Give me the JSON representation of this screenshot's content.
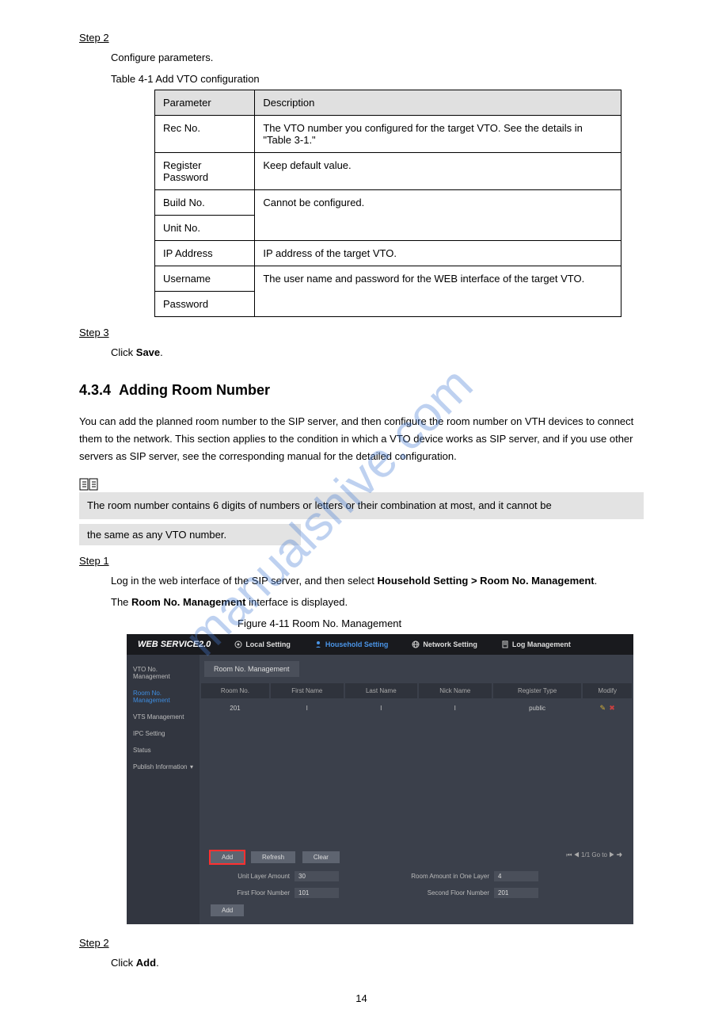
{
  "step2": {
    "label": "Step 2",
    "desc": "Configure parameters.",
    "tableCaption": "Table 4-1   Add VTO configuration",
    "headers": [
      "Parameter",
      "Description"
    ],
    "rows": [
      [
        "Rec No.",
        "The VTO number you configured for the target VTO. See the details in \"Table 3-1.\""
      ],
      [
        "Register Password",
        "Keep default value."
      ],
      [
        "Build No.",
        ""
      ],
      [
        "Unit No.",
        "Cannot be configured."
      ],
      [
        "IP Address",
        "IP address of the target VTO."
      ],
      [
        "Username",
        ""
      ],
      [
        "Password",
        "The user name and password for the WEB interface of the target VTO."
      ]
    ]
  },
  "step3": {
    "label": "Step 3",
    "desc": "Click Save."
  },
  "section": {
    "number": "4.3.4",
    "title": "Adding Room Number",
    "text": "You can add the planned room number to the SIP server, and then configure the room number on VTH devices to connect them to the network. This section applies to the condition in which a VTO device works as SIP server, and if you use other servers as SIP server, see the corresponding manual for the detailed configuration.",
    "noteLine1": "The room number contains 6 digits of numbers or letters or their combination at most, and it cannot be",
    "noteLine2": "the same as any VTO number."
  },
  "step1": {
    "label": "Step 1",
    "line1": "Log in the web interface of the SIP server, and then select Household Setting > Room No. Management.",
    "line2": "The Room No. Management interface is displayed.",
    "figureCaption": "Figure 4-11   Room No. Management"
  },
  "screenshot": {
    "logo": "WEB SERVICE2.0",
    "nav": [
      "Local Setting",
      "Household Setting",
      "Network Setting",
      "Log Management"
    ],
    "sidebar": [
      "VTO No. Management",
      "Room No. Management",
      "VTS Management",
      "IPC Setting",
      "Status",
      "Publish Information"
    ],
    "tabTitle": "Room No. Management",
    "tableHeaders": [
      "Room No.",
      "First Name",
      "Last Name",
      "Nick Name",
      "Register Type",
      "Modify"
    ],
    "tableRow": [
      "201",
      "l",
      "l",
      "l",
      "public"
    ],
    "buttons": [
      "Add",
      "Refresh",
      "Clear",
      "Add"
    ],
    "pager": "1/1   Go to",
    "fields": {
      "unitLayerAmount": {
        "label": "Unit Layer Amount",
        "value": "30"
      },
      "firstFloorNumber": {
        "label": "First Floor Number",
        "value": "101"
      },
      "roomAmountOneLayer": {
        "label": "Room Amount in One Layer",
        "value": "4"
      },
      "secondFloorNumber": {
        "label": "Second Floor Number",
        "value": "201"
      }
    }
  },
  "step2b": {
    "label": "Step 2",
    "desc": "Click Add."
  },
  "pageNum": "14",
  "watermarkText": "manualshive.com"
}
